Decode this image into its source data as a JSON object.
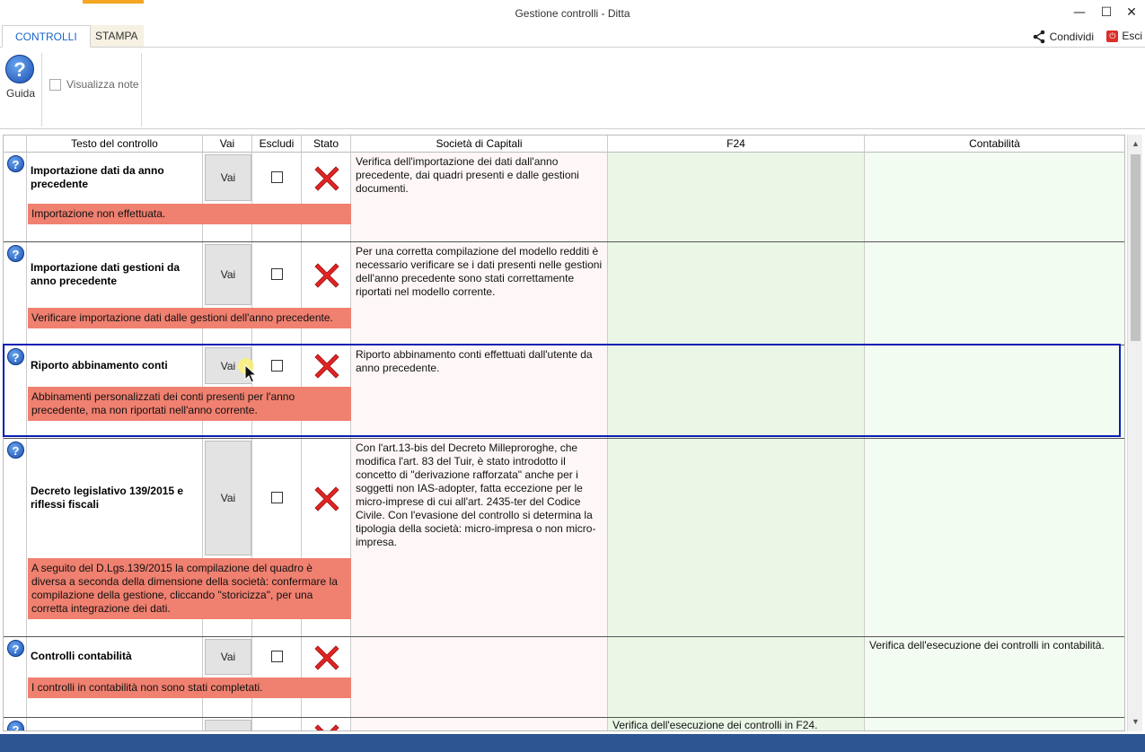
{
  "window": {
    "title": "Gestione controlli - Ditta",
    "minimize_glyph": "—",
    "maximize_glyph": "☐",
    "close_glyph": "✕"
  },
  "tabs": [
    {
      "label": "CONTROLLI",
      "active": true
    },
    {
      "label": "STAMPA",
      "active": false
    }
  ],
  "actions": {
    "share_label": "Condividi",
    "exit_label": "Esci"
  },
  "ribbon": {
    "guida_label": "Guida",
    "help_glyph": "?",
    "visualizza_note_label": "Visualizza note",
    "visualizza_note_checked": false
  },
  "grid": {
    "columns": {
      "testo": "Testo del controllo",
      "vai": "Vai",
      "escludi": "Escludi",
      "stato": "Stato",
      "societa": "Società di Capitali",
      "f24": "F24",
      "contabilita": "Contabilità"
    },
    "rows": [
      {
        "name": "Importazione dati da anno precedente",
        "vai": "Vai",
        "message": "Importazione non effettuata.",
        "societa": "Verifica dell'importazione dei dati dall'anno precedente, dai quadri presenti e dalle gestioni documenti.",
        "f24": "",
        "contabilita": ""
      },
      {
        "name": "Importazione dati gestioni da anno precedente",
        "vai": "Vai",
        "message": "Verificare importazione dati dalle gestioni dell'anno precedente.",
        "societa": "Per una corretta compilazione del modello redditi è necessario verificare se i dati presenti nelle gestioni dell'anno precedente sono stati correttamente riportati nel modello corrente.",
        "f24": "",
        "contabilita": ""
      },
      {
        "name": "Riporto abbinamento conti",
        "vai": "Vai",
        "message": "Abbinamenti personalizzati dei conti presenti per l'anno precedente, ma non riportati nell'anno corrente.",
        "societa": "Riporto abbinamento conti effettuati dall'utente da anno precedente.",
        "f24": "",
        "contabilita": ""
      },
      {
        "name": "Decreto legislativo 139/2015 e riflessi fiscali",
        "vai": "Vai",
        "message": "A seguito del D.Lgs.139/2015 la compilazione del quadro è diversa a seconda della dimensione della società: confermare la compilazione della gestione, cliccando \"storicizza\", per una corretta integrazione dei dati.",
        "societa": "Con l'art.13-bis del Decreto Milleproroghe, che modifica l'art. 83 del Tuir, è stato introdotto il concetto di \"derivazione rafforzata\" anche per i soggetti non IAS-adopter, fatta eccezione per le micro-imprese di cui all'art. 2435-ter del Codice Civile. Con l'evasione del controllo si determina la tipologia della società: micro-impresa o non micro-impresa.",
        "f24": "",
        "contabilita": ""
      },
      {
        "name": "Controlli contabilità",
        "vai": "Vai",
        "message": "I controlli in contabilità non sono stati completati.",
        "societa": "",
        "f24": "",
        "contabilita": "Verifica dell'esecuzione dei controlli in contabilità."
      },
      {
        "name": "",
        "vai": "",
        "message": "",
        "societa": "",
        "f24": "Verifica dell'esecuzione dei controlli in F24.",
        "contabilita": ""
      }
    ]
  },
  "scrollbar": {
    "up_glyph": "▲",
    "down_glyph": "▼"
  },
  "colors": {
    "accent": "#1b64c7",
    "message_bg": "#f08070",
    "selection_border": "#0a1fb5",
    "status_bar": "#2c5591",
    "error_x": "#e02424"
  }
}
